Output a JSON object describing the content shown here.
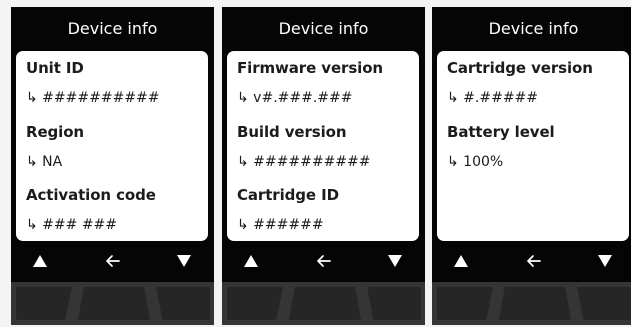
{
  "screens": [
    {
      "title": "Device info",
      "lines": [
        {
          "kind": "label",
          "text": "Unit ID"
        },
        {
          "kind": "value",
          "text": "↳ ##########"
        },
        {
          "kind": "label",
          "text": "Region"
        },
        {
          "kind": "value",
          "text": "↳ NA"
        },
        {
          "kind": "label",
          "text": "Activation code"
        },
        {
          "kind": "value",
          "text": "↳ ### ###"
        }
      ],
      "nav": {
        "up": "▲",
        "back": "←",
        "down": "▼"
      }
    },
    {
      "title": "Device info",
      "lines": [
        {
          "kind": "label",
          "text": "Firmware version"
        },
        {
          "kind": "value",
          "text": "↳ v#.###.###"
        },
        {
          "kind": "label",
          "text": "Build version"
        },
        {
          "kind": "value",
          "text": "↳ ##########"
        },
        {
          "kind": "label",
          "text": "Cartridge ID"
        },
        {
          "kind": "value",
          "text": "↳ ######"
        }
      ],
      "nav": {
        "up": "▲",
        "back": "←",
        "down": "▼"
      }
    },
    {
      "title": "Device info",
      "lines": [
        {
          "kind": "label",
          "text": "Cartridge version"
        },
        {
          "kind": "value",
          "text": "↳ #.#####"
        },
        {
          "kind": "label",
          "text": "Battery level"
        },
        {
          "kind": "value",
          "text": "↳ 100%"
        }
      ],
      "nav": {
        "up": "▲",
        "back": "←",
        "down": "▼"
      }
    }
  ],
  "icons": {
    "up": "triangle-up-icon",
    "back": "arrow-left-icon",
    "down": "triangle-down-icon"
  },
  "colors": {
    "screen_background": "#050505",
    "panel_background": "#ffffff",
    "panel_text": "#1c1c1c",
    "header_text": "#ffffff",
    "key_background": "#262626",
    "key_frame": "#353535"
  }
}
